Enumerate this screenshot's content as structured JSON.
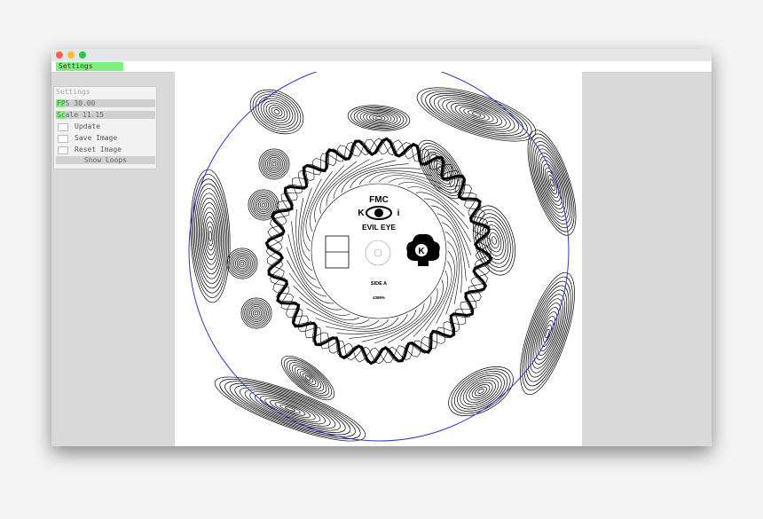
{
  "menu": {
    "settings_label": "Settings"
  },
  "panel": {
    "title": "Settings",
    "fps_label": "FPS 30.00",
    "fps_value": 30.0,
    "scale_label": "Scale 11.15",
    "scale_value": 11.15,
    "checkboxes": [
      {
        "label": "Update",
        "checked": false
      },
      {
        "label": "Save Image",
        "checked": false
      },
      {
        "label": "Reset Image",
        "checked": false
      }
    ],
    "show_loops_label": "Show Loops"
  },
  "record_label": {
    "brand": "FMC",
    "left_letter": "K",
    "right_letter": "i",
    "title": "EVIL EYE",
    "logo_letter": "K",
    "side": "SIDE A",
    "catalog": "4389%"
  },
  "colors": {
    "accent": "#7ff07f",
    "outline": "#3333cc",
    "ink": "#000000"
  }
}
